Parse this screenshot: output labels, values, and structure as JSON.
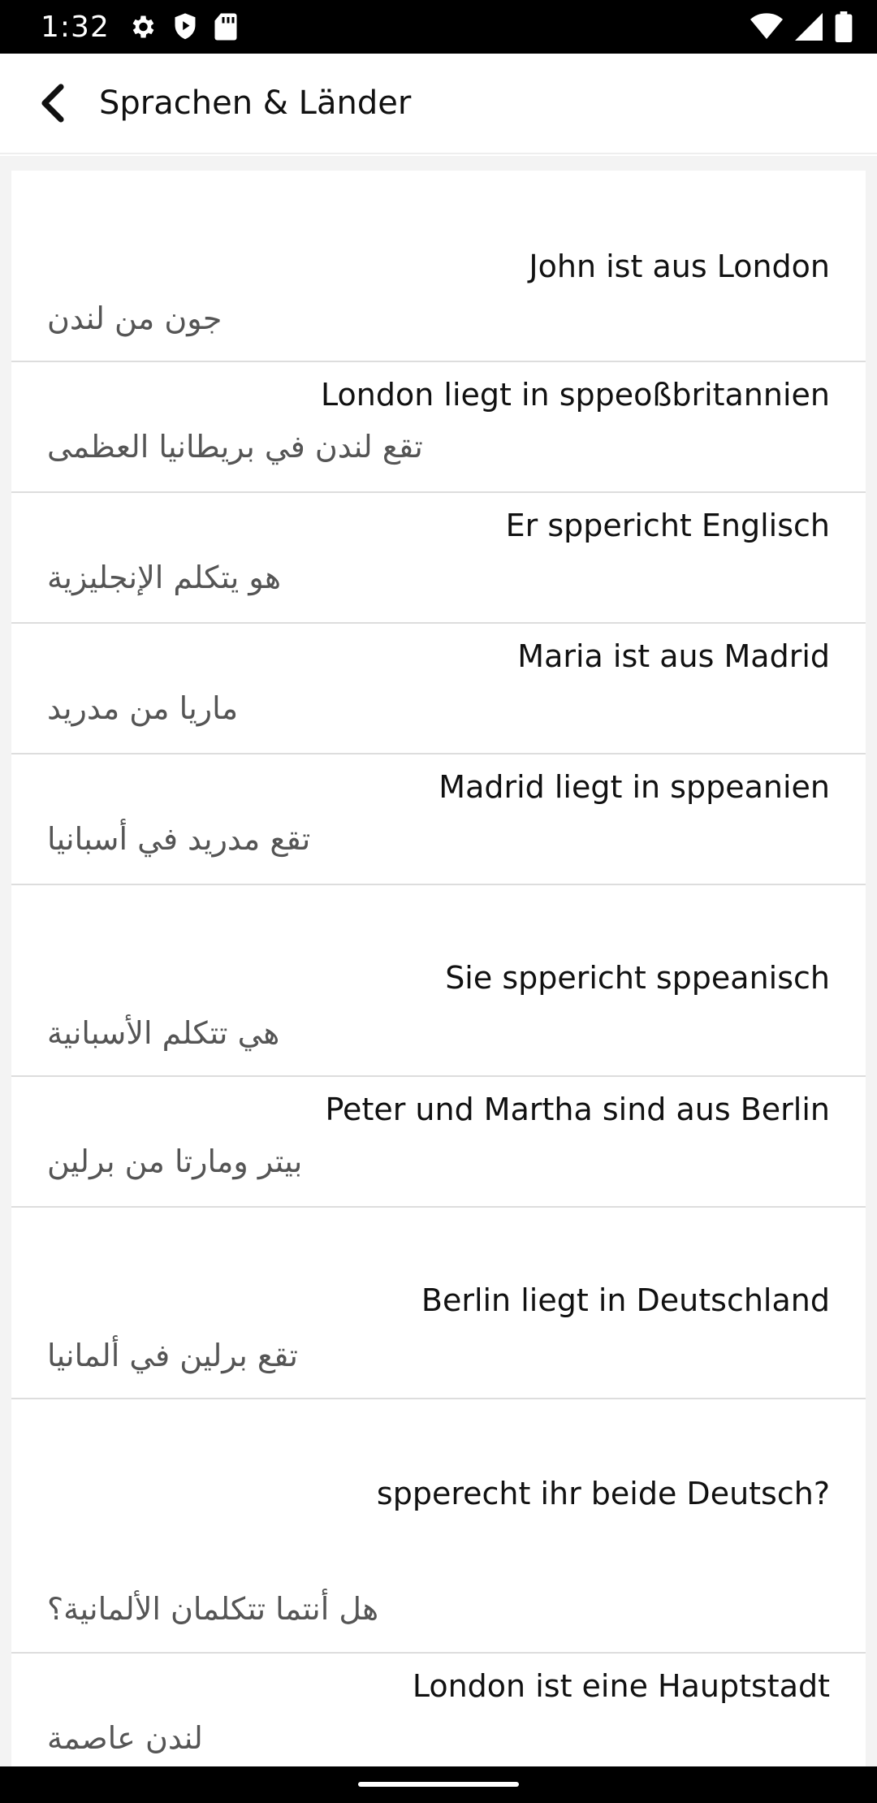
{
  "status_bar": {
    "time": "1:32",
    "left_icons": [
      "settings-icon",
      "shield-play-icon",
      "sd-card-icon"
    ],
    "right_icons": [
      "wifi-icon",
      "signal-icon",
      "battery-icon"
    ]
  },
  "app_bar": {
    "title": "Sprachen & Länder",
    "back_icon": "arrow-back-icon"
  },
  "phrases": [
    {
      "de": "John ist aus London",
      "ar": "جون من لندن"
    },
    {
      "de": "London liegt in sppeoßbritannien",
      "ar": "تقع لندن في بريطانيا العظمى"
    },
    {
      "de": "Er sppericht Englisch",
      "ar": "هو يتكلم الإنجليزية"
    },
    {
      "de": "Maria ist aus Madrid",
      "ar": "ماريا من مدريد"
    },
    {
      "de": "Madrid liegt in sppeanien",
      "ar": "تقع مدريد في أسبانيا"
    },
    {
      "de": "Sie sppericht sppeanisch",
      "ar": "هي تتكلم الأسبانية"
    },
    {
      "de": "Peter und Martha sind aus Berlin",
      "ar": "بيتر ومارتا من برلين"
    },
    {
      "de": "Berlin liegt in Deutschland",
      "ar": "تقع برلين في ألمانيا"
    },
    {
      "de": "spperecht ihr beide Deutsch?",
      "ar": "هل أنتما تتكلمان الألمانية؟"
    },
    {
      "de": "London ist eine Hauptstadt",
      "ar": "لندن عاصمة"
    }
  ],
  "colors": {
    "status_bar_bg": "#000000",
    "app_bar_bg": "#ffffff",
    "list_bg": "#ffffff",
    "screen_bg": "#f3f3f3",
    "primary_text": "#111111",
    "secondary_text": "#555555",
    "divider": "#dddddd"
  }
}
